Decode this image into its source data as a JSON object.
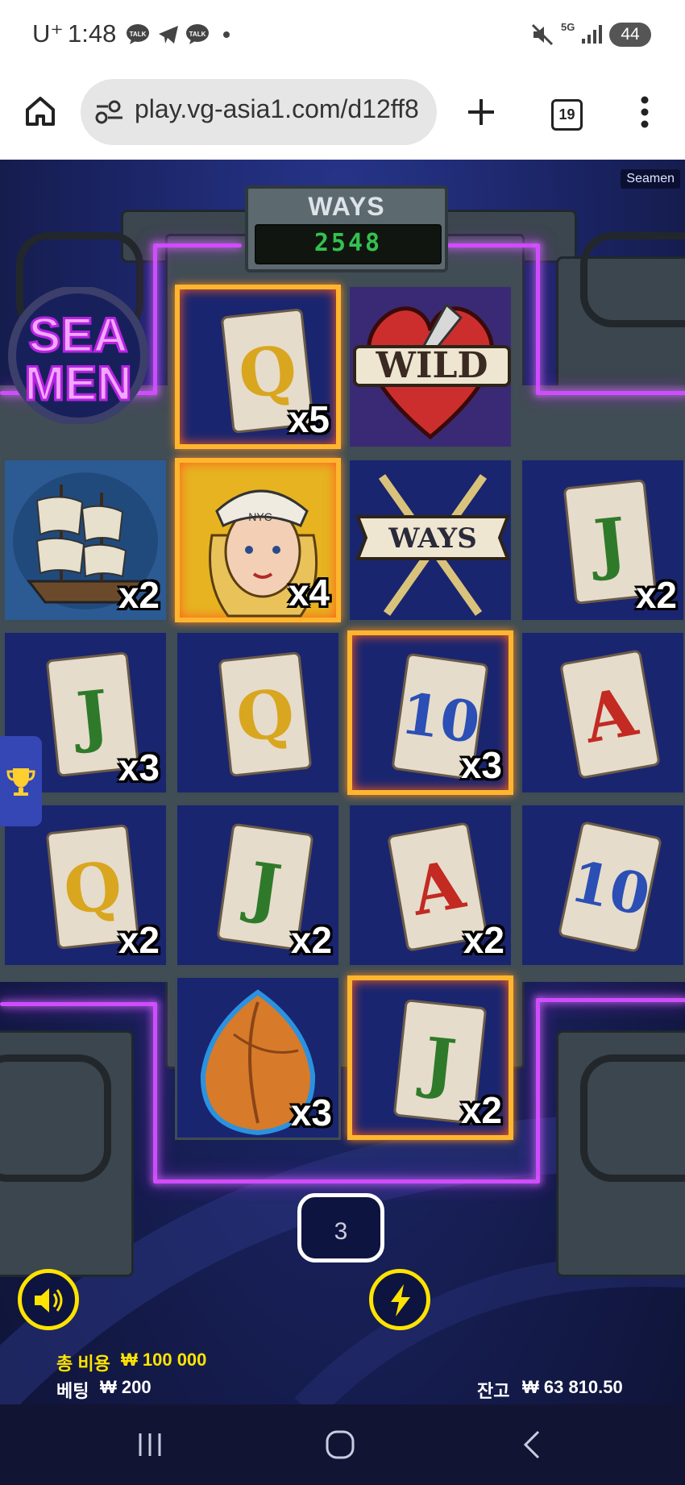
{
  "status_bar": {
    "carrier": "U⁺",
    "time": "1:48",
    "battery": "44",
    "network": "5G"
  },
  "browser": {
    "url": "play.vg-asia1.com/d12ff8",
    "tab_count": "19"
  },
  "game": {
    "corner_tag": "Seamen",
    "ways_label": "WAYS",
    "ways_value": "2548",
    "logo_line1": "SEA",
    "logo_line2": "MEN",
    "wild_label": "WILD",
    "ways_banner_label": "WAYS",
    "sailor_cap_text": "NYC",
    "spin_counter": "3",
    "cells": {
      "r1c2": {
        "symbol": "Q",
        "mult": "x5"
      },
      "r2c1": {
        "mult": "x2"
      },
      "r2c2": {
        "mult": "x4"
      },
      "r2c4": {
        "symbol": "J",
        "mult": "x2"
      },
      "r3c1": {
        "symbol": "J",
        "mult": "x3"
      },
      "r3c2": {
        "symbol": "Q"
      },
      "r3c3": {
        "symbol": "10",
        "mult": "x3"
      },
      "r3c4": {
        "symbol": "A"
      },
      "r4c1": {
        "symbol": "Q",
        "mult": "x2"
      },
      "r4c2": {
        "symbol": "J",
        "mult": "x2"
      },
      "r4c3": {
        "symbol": "A",
        "mult": "x2"
      },
      "r4c4": {
        "symbol": "10"
      },
      "r5c2": {
        "mult": "x3"
      },
      "r5c3": {
        "symbol": "J",
        "mult": "x2"
      }
    },
    "footer": {
      "total_cost_label": "총 비용",
      "total_cost_value": "₩ 100 000",
      "bet_label": "베팅",
      "bet_value": "₩ 200",
      "balance_label": "잔고",
      "balance_value": "₩ 63 810.50"
    }
  },
  "colors": {
    "neon": "#d14cff",
    "accent_yellow": "#ffe300",
    "ways_green": "#33c24f",
    "letter_gold": "#d9a620",
    "letter_green": "#2f7a2a",
    "letter_blue": "#2b4fb5",
    "letter_red": "#c22a22"
  }
}
